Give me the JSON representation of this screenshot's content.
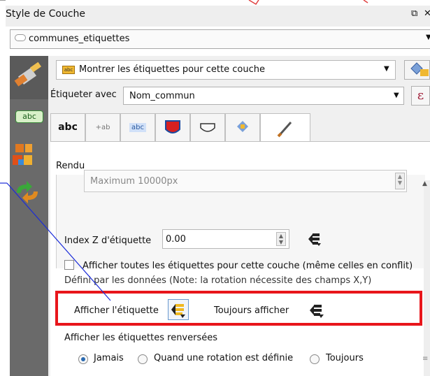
{
  "window": {
    "title": "Style de Couche",
    "float_glyph": "⧉",
    "close_glyph": "✕"
  },
  "layer": {
    "name": "communes_etiquettes",
    "icon": "polygon-layer-icon"
  },
  "labels": {
    "mode": "Montrer les étiquettes pour cette couche",
    "label_with_caption": "Étiqueter avec",
    "field": "Nom_commun",
    "expression_glyph": "ε"
  },
  "sidebar": {
    "abc": "abc"
  },
  "tabs": [
    {
      "label": "abc",
      "icon": "text-tab-icon"
    },
    {
      "label": "+ab / c",
      "icon": "formatting-tab-icon"
    },
    {
      "label": "abc",
      "icon": "buffer-tab-icon"
    },
    {
      "label": "",
      "icon": "background-tab-icon"
    },
    {
      "label": "",
      "icon": "shadow-tab-icon"
    },
    {
      "label": "",
      "icon": "placement-tab-icon"
    },
    {
      "label": "",
      "icon": "rendering-tab-icon"
    }
  ],
  "rendering": {
    "section_title": "Rendu",
    "max_value": "Maximum 10000px",
    "z_label": "Index Z d'étiquette",
    "z_value": "0.00",
    "show_all_text": "Afficher toutes les étiquettes pour cette couche (même celles en conflit)",
    "data_defined_text": "Défini par les données (Note: la rotation nécessite des champs X,Y)",
    "show_label_text": "Afficher l'étiquette",
    "always_show_text": "Toujours afficher",
    "reversed_title": "Afficher les étiquettes renversées",
    "radio_options": [
      "Jamais",
      "Quand une rotation est définie",
      "Toujours"
    ],
    "radio_selected": "Jamais"
  },
  "colors": {
    "highlight": "#e8161b",
    "pointer_line": "#1a2bd8",
    "top_marks": "#e04040"
  }
}
